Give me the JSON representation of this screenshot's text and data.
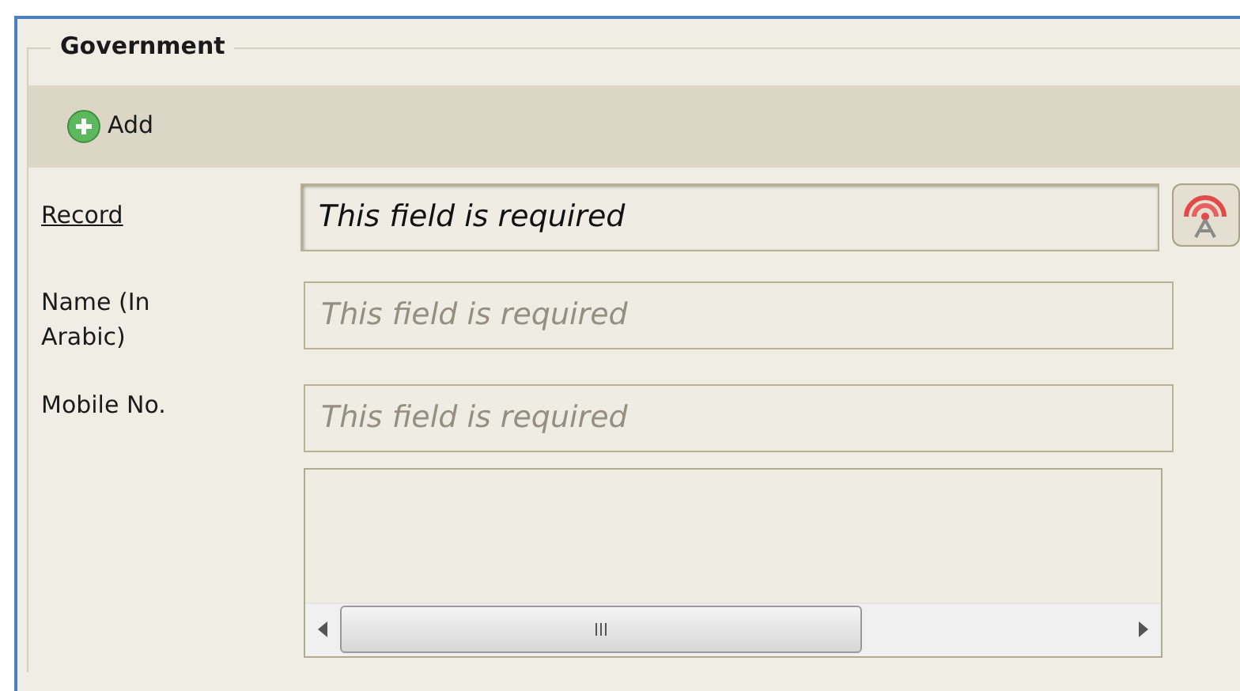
{
  "section": {
    "title": "Government"
  },
  "toolbar": {
    "add_button": {
      "label": "Add"
    }
  },
  "fields": [
    {
      "kind": "lookup",
      "label": "Record",
      "value": "This field is required"
    },
    {
      "kind": "text",
      "label": "Name (In Arabic)",
      "placeholder": "This field is required"
    },
    {
      "kind": "text",
      "label": "Mobile No.",
      "placeholder": "This field is required"
    },
    {
      "kind": "list"
    }
  ]
}
